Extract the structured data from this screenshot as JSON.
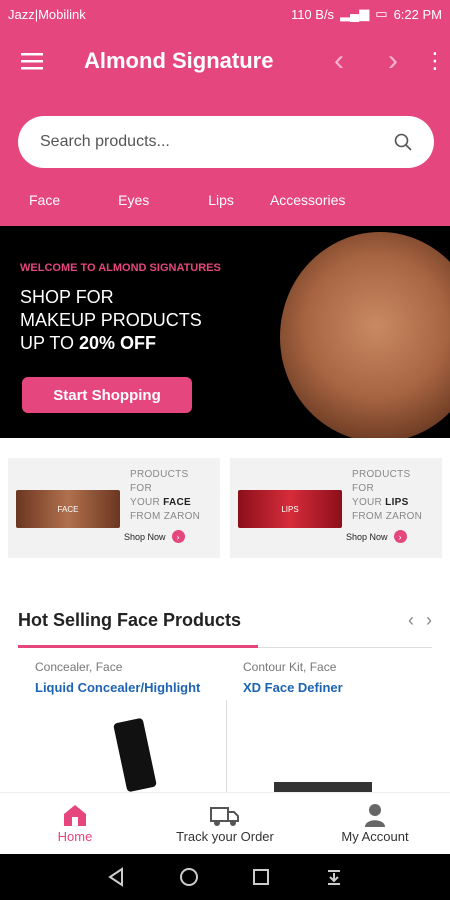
{
  "status": {
    "carrier": "Jazz|Mobilink",
    "speed": "110 B/s",
    "time": "6:22 PM"
  },
  "appbar": {
    "title": "Almond Signature",
    "icons": [
      "menu-icon",
      "chevron-left-icon",
      "chevron-right-icon",
      "more-vert-icon"
    ]
  },
  "search": {
    "placeholder": "Search products..."
  },
  "categories": [
    "Face",
    "Eyes",
    "Lips",
    "Accessories"
  ],
  "banner": {
    "welcome": "WELCOME TO ALMOND SIGNATURES",
    "line1": "SHOP FOR",
    "line2": "MAKEUP PRODUCTS",
    "line3_pre": "UP TO ",
    "line3_bold": "20% OFF",
    "cta": "Start Shopping"
  },
  "promos": [
    {
      "thumb_text": "FACE",
      "l1": "PRODUCTS FOR",
      "l2_pre": "YOUR ",
      "l2_bold": "FACE",
      "l3": "FROM ZARON",
      "shop": "Shop Now"
    },
    {
      "thumb_text": "LIPS",
      "l1": "PRODUCTS FOR",
      "l2_pre": "YOUR ",
      "l2_bold": "LIPS",
      "l3": "FROM ZARON",
      "shop": "Shop Now"
    }
  ],
  "section": {
    "title": "Hot Selling Face Products"
  },
  "products": [
    {
      "category": "Concealer, Face",
      "name": "Liquid Concealer/Highlight"
    },
    {
      "category": "Contour Kit, Face",
      "name": "XD Face Definer"
    }
  ],
  "bottom_nav": [
    {
      "label": "Home",
      "icon": "home-icon"
    },
    {
      "label": "Track your Order",
      "icon": "truck-icon"
    },
    {
      "label": "My Account",
      "icon": "account-icon"
    }
  ],
  "colors": {
    "accent": "#e5467e",
    "link": "#1e63b3"
  }
}
